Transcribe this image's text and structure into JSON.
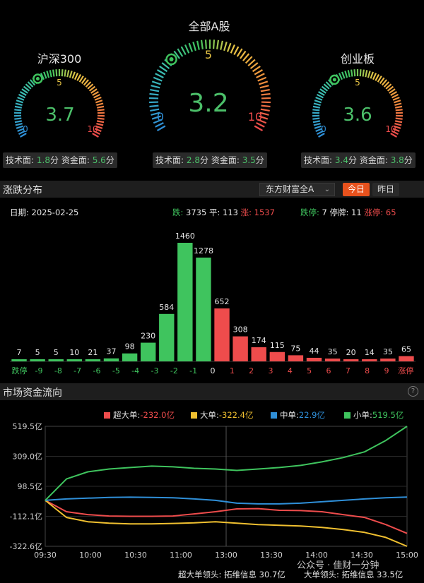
{
  "gauges": [
    {
      "name": "沪深300",
      "value": "3.7",
      "score": 3.7,
      "min": "0",
      "mid": "5",
      "max": "10",
      "tech_label": "技术面:",
      "tech_value": "1.8",
      "tech_unit": "分",
      "fund_label": "资金面:",
      "fund_value": "5.6",
      "fund_unit": "分"
    },
    {
      "name": "全部A股",
      "value": "3.2",
      "score": 3.2,
      "min": "0",
      "mid": "5",
      "max": "10",
      "tech_label": "技术面:",
      "tech_value": "2.8",
      "tech_unit": "分",
      "fund_label": "资金面:",
      "fund_value": "3.5",
      "fund_unit": "分"
    },
    {
      "name": "创业板",
      "value": "3.6",
      "score": 3.6,
      "min": "0",
      "mid": "5",
      "max": "10",
      "tech_label": "技术面:",
      "tech_value": "3.4",
      "tech_unit": "分",
      "fund_label": "资金面:",
      "fund_value": "3.8",
      "fund_unit": "分"
    }
  ],
  "distribution": {
    "title": "涨跌分布",
    "select_value": "东方财富全A",
    "tab_today": "今日",
    "tab_yesterday": "昨日",
    "date_label": "日期:",
    "date": "2025-02-25",
    "fall_label": "跌:",
    "fall_value": "3735",
    "flat_label": "平:",
    "flat_value": "113",
    "rise_label": "涨:",
    "rise_value": "1537",
    "limit_down_label": "跌停:",
    "limit_down_value": "7",
    "suspended_label": "停牌:",
    "suspended_value": "11",
    "limit_up_label": "涨停:",
    "limit_up_value": "65"
  },
  "flow": {
    "title": "市场资金流向",
    "legend": [
      {
        "label": "超大单:",
        "value": "-232.0亿",
        "color": "#ee4c4c"
      },
      {
        "label": "大单:",
        "value": "-322.4亿",
        "color": "#f0c030"
      },
      {
        "label": "中单:",
        "value": "22.9亿",
        "color": "#2f8fd8"
      },
      {
        "label": "小单:",
        "value": "519.5亿",
        "color": "#3fc45e"
      }
    ],
    "leader1_label": "超大单领头:",
    "leader1_value": "拓维信息 30.7亿",
    "leader2_label": "大单领头:",
    "leader2_value": "拓维信息 33.5亿",
    "watermark": "公众号 · 佳财一分钟"
  },
  "colors": {
    "green": "#3fc45e",
    "red": "#ee4c4c",
    "yellow": "#f0c030",
    "blue": "#2f8fd8",
    "accent": "#e8521d"
  },
  "chart_data": [
    {
      "type": "bar",
      "categories": [
        "跌停",
        "-9",
        "-8",
        "-7",
        "-6",
        "-5",
        "-4",
        "-3",
        "-2",
        "-1",
        "0",
        "1",
        "2",
        "3",
        "4",
        "5",
        "6",
        "7",
        "8",
        "9",
        "涨停"
      ],
      "values": [
        7,
        5,
        5,
        10,
        21,
        37,
        98,
        230,
        584,
        1460,
        1278,
        652,
        308,
        174,
        115,
        75,
        44,
        35,
        20,
        14,
        35,
        65
      ],
      "bar_values": [
        7,
        5,
        5,
        10,
        21,
        37,
        98,
        230,
        584,
        1460,
        1278,
        652,
        308,
        174,
        115,
        75,
        44,
        35,
        20,
        14,
        35,
        65
      ],
      "bar_colors": [
        "green",
        "green",
        "green",
        "green",
        "green",
        "green",
        "green",
        "green",
        "green",
        "green",
        "green",
        "red",
        "red",
        "red",
        "red",
        "red",
        "red",
        "red",
        "red",
        "red",
        "red",
        "red"
      ],
      "tick_labels": [
        "跌停",
        "-9",
        "-8",
        "-7",
        "-6",
        "-5",
        "-4",
        "-3",
        "-2",
        "-1",
        "0",
        "1",
        "2",
        "3",
        "4",
        "5",
        "6",
        "7",
        "8",
        "9",
        "涨停"
      ],
      "ylim": [
        0,
        1460
      ]
    },
    {
      "type": "line",
      "x_labels": [
        "09:30",
        "10:00",
        "10:30",
        "11:00",
        "13:00",
        "13:30",
        "14:00",
        "14:30",
        "15:00"
      ],
      "y_ticks": [
        "519.5亿",
        "309.0亿",
        "98.5亿",
        "-112.1亿",
        "-322.6亿"
      ],
      "ylim": [
        -322.6,
        519.5
      ],
      "series": [
        {
          "name": "超大单",
          "color": "#ee4c4c",
          "values": [
            0,
            -80,
            -100,
            -110,
            -112,
            -112,
            -110,
            -95,
            -80,
            -60,
            -58,
            -70,
            -72,
            -80,
            -100,
            -120,
            -170,
            -232
          ]
        },
        {
          "name": "大单",
          "color": "#f0c030",
          "values": [
            0,
            -120,
            -150,
            -160,
            -165,
            -165,
            -162,
            -158,
            -150,
            -160,
            -170,
            -175,
            -180,
            -190,
            -205,
            -225,
            -260,
            -322.4
          ]
        },
        {
          "name": "中单",
          "color": "#2f8fd8",
          "values": [
            0,
            10,
            15,
            20,
            22,
            20,
            18,
            10,
            0,
            -20,
            -25,
            -25,
            -20,
            -10,
            0,
            10,
            18,
            22.9
          ]
        },
        {
          "name": "小单",
          "color": "#3fc45e",
          "values": [
            0,
            150,
            200,
            220,
            230,
            240,
            235,
            225,
            220,
            210,
            220,
            230,
            245,
            270,
            300,
            340,
            420,
            519.5
          ]
        }
      ]
    }
  ]
}
